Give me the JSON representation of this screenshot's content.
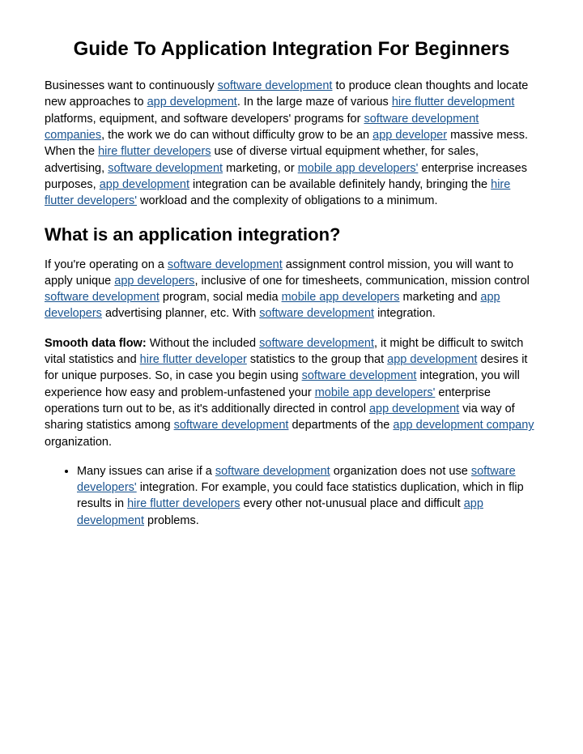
{
  "title": "Guide To Application Integration For Beginners",
  "para1": {
    "t1": "Businesses want to continuously ",
    "link1": "software development",
    "t2": " to produce clean thoughts and locate new approaches to ",
    "link2": "app development",
    "t3": ". In the large maze of various ",
    "link3": "hire flutter development",
    "t4": " platforms, equipment, and software developers' programs for ",
    "link4": "software development companies",
    "t5": ", the work we do can without difficulty grow to be an ",
    "link5": "app developer",
    "t6": " massive mess. When the ",
    "link6": "hire flutter developers",
    "t7": " use of diverse virtual equipment whether, for sales, advertising, ",
    "link7": "software development",
    "t8": " marketing, or ",
    "link8": "mobile app developers'",
    "t9": " enterprise increases purposes, ",
    "link9": "app development",
    "t10": " integration can be available definitely handy, bringing the ",
    "link10": "hire flutter developers'",
    "t11": " workload and the complexity of obligations to a minimum."
  },
  "heading2": "What is an application integration?",
  "para2": {
    "t1": "If you're operating on a ",
    "link1": "software development",
    "t2": " assignment control mission, you will want to apply unique ",
    "link2": "app developers",
    "t3": ", inclusive of one for timesheets, communication, mission control ",
    "link3": "software development",
    "t4": " program, social media ",
    "link4": "mobile app developers",
    "t5": " marketing and ",
    "link5": "app developers",
    "t6": " advertising planner, etc. With ",
    "link6": "software development",
    "t7": " integration."
  },
  "para3": {
    "bold1": "Smooth data flow:",
    "t1": " Without the included ",
    "link1": "software development",
    "t2": ", it might be difficult to switch vital statistics and ",
    "link2": "hire flutter developer",
    "t3": " statistics to the group that ",
    "link3": "app development",
    "t4": " desires it for unique purposes. So, in case you begin using ",
    "link4": "software development",
    "t5": " integration, you will experience how easy and problem-unfastened your ",
    "link5": "mobile app developers'",
    "t6": " enterprise operations turn out to be, as it's additionally directed in control ",
    "link6": "app development",
    "t7": " via way of sharing statistics among ",
    "link7": "software development",
    "t8": " departments of the ",
    "link8": "app development company",
    "t9": " organization."
  },
  "bullet1": {
    "t1": "Many issues can arise if a ",
    "link1": "software development",
    "t2": " organization does not use ",
    "link2": "software developers'",
    "t3": " integration. For example, you could face statistics duplication, which in flip results in ",
    "link3": "hire flutter developers",
    "t4": " every other not-unusual place and difficult ",
    "link4": "app development",
    "t5": " problems."
  }
}
